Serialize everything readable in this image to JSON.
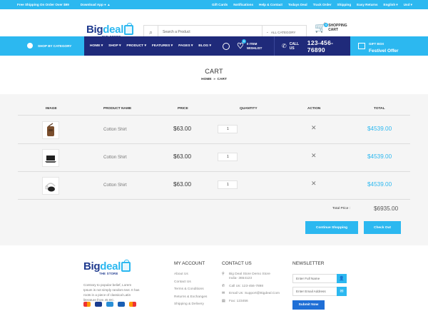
{
  "topbar": {
    "shipping": "Free Shipping On Order Over $99",
    "download": "Download App",
    "links": [
      "Gift Cards",
      "Notifications",
      "Help & Contact",
      "Todays Deal",
      "Track Order",
      "Shipping",
      "Easy Returns"
    ],
    "language": "English",
    "currency": "Usd"
  },
  "header": {
    "logo_main": "Big",
    "logo_accent": "deal",
    "logo_sub": "THE STORE",
    "search_placeholder": "Search a Product",
    "category": "ALL CATEGORY",
    "cart_line1": "SHOPPING",
    "cart_line2": "CART",
    "cart_count": "0"
  },
  "nav": {
    "shop_by_category": "SHOP BY CATEGORY",
    "menu": [
      "HOME ▾",
      "SHOP ▾",
      "PRODUCT ▾",
      "FEATURES ▾",
      "PAGES ▾",
      "BLOG ▾"
    ],
    "wishlist_line1": "0 ITEM",
    "wishlist_line2": "WISHLIST",
    "wishlist_count": "0",
    "call_label": "CALL US",
    "phone": "123-456-76890",
    "gift_line1": "GIFT BOX",
    "gift_line2": "Festivel Offer"
  },
  "breadcrumb": {
    "title": "CART",
    "home": "HOME",
    "sep": "»",
    "current": "CART"
  },
  "table": {
    "headers": [
      "IMAGE",
      "PRODUCT NAME",
      "PRICE",
      "QUANTITY",
      "ACTION",
      "TOTAL"
    ],
    "rows": [
      {
        "image": "bag",
        "name": "Cotton Shirt",
        "price": "$63.00",
        "qty": "1",
        "total": "$4539.00"
      },
      {
        "image": "laptop",
        "name": "Cotton Shirt",
        "price": "$63.00",
        "qty": "1",
        "total": "$4539.00"
      },
      {
        "image": "headphones",
        "name": "Cotton Shirt",
        "price": "$63.00",
        "qty": "1",
        "total": "$4539.00"
      }
    ],
    "total_label": "Total Price :",
    "total_value": "$6935.00",
    "continue_btn": "Continue Shopping",
    "checkout_btn": "Check Out"
  },
  "footer": {
    "logo_main": "Big",
    "logo_accent": "deal",
    "logo_sub": "THE STORE",
    "desc": "Contrary to popular belief, Lorem Ipsum is not simply random text. It has roots in a piece of classical Latin literature from 45 BC.",
    "account_title": "MY ACCOUNT",
    "account_links": [
      "About Us",
      "Contact Us",
      "Terms & Conditions",
      "Returns & Exchanges",
      "Shipping & Delivery"
    ],
    "contact_title": "CONTACT US",
    "address": "Big Deal Store Demo Store India- 3654123",
    "call": "Call Us: 123-456-7898",
    "email": "Email Us: Support@Bigdeal.Com",
    "fax": "Fax: 123456",
    "newsletter_title": "NEWSLETTER",
    "name_placeholder": "Enter Full Name",
    "email_placeholder": "Enter Email Address",
    "submit": "Submit Now"
  },
  "colors": {
    "accent": "#2cb8f0",
    "navy": "#1f2a7a",
    "submit": "#1f6fd6"
  }
}
